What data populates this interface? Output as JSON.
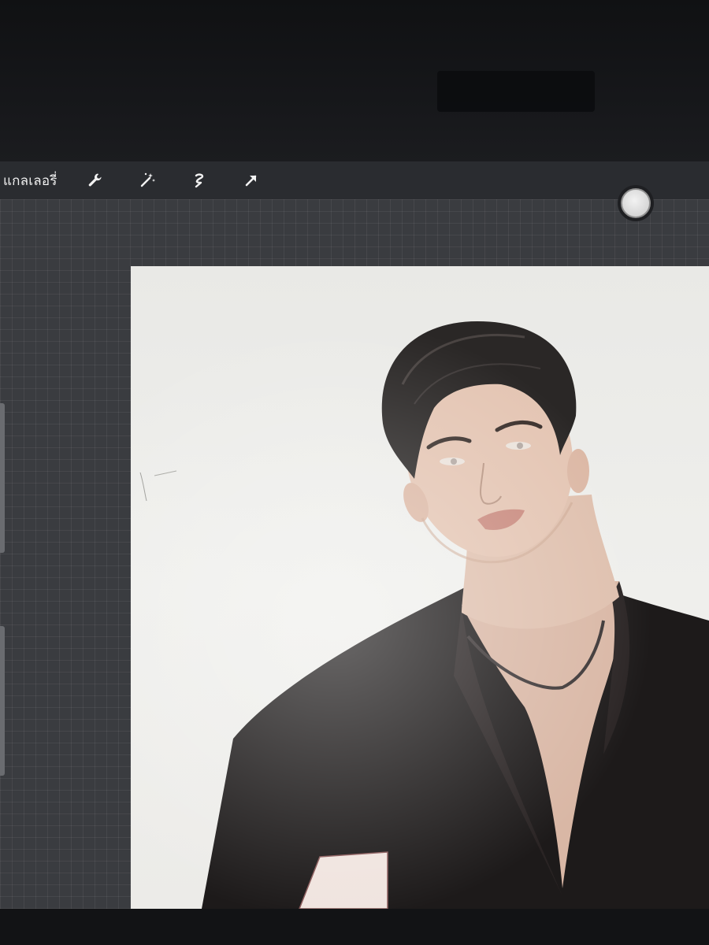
{
  "toolbar": {
    "gallery_label": "แกลเลอรี่",
    "tools": [
      {
        "name": "wrench-icon"
      },
      {
        "name": "magic-wand-icon"
      },
      {
        "name": "selection-icon"
      },
      {
        "name": "transform-arrow-icon"
      }
    ]
  },
  "color_picker": {
    "current_color": "#e6e6e6"
  },
  "canvas": {
    "background": "#ececea",
    "subject": "illustration-of-man-in-black-shirt"
  },
  "colors": {
    "toolbar_bg": "#2a2c30",
    "workspace_bg": "#3a3c40",
    "hair": "#2a2726",
    "skin": "#e2c2b0",
    "shirt": "#1d1a1a"
  }
}
